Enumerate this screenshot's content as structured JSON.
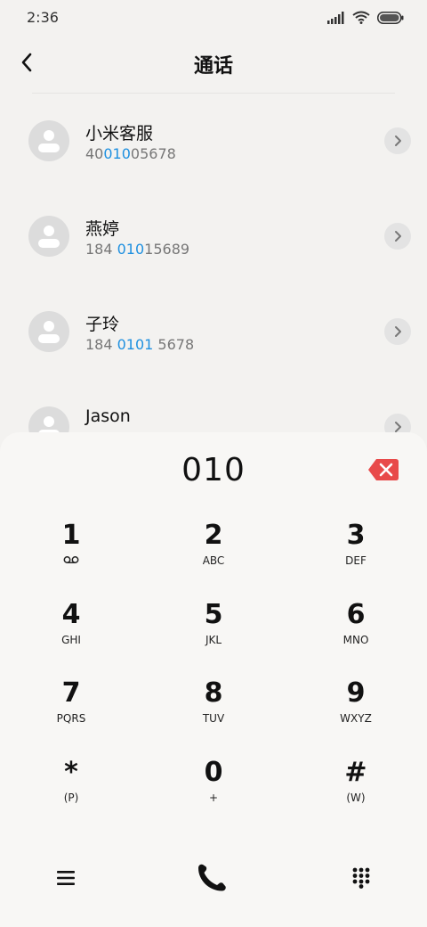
{
  "status_bar": {
    "time": "2:36"
  },
  "header": {
    "title": "通话"
  },
  "contacts": [
    {
      "name": "小米客服",
      "number_parts": [
        "40",
        "010",
        "05678"
      ]
    },
    {
      "name": "燕婷",
      "number_parts": [
        "184 ",
        "010",
        "15689"
      ]
    },
    {
      "name": "子玲",
      "number_parts": [
        "184 ",
        "0101",
        " 5678"
      ]
    },
    {
      "name": "Jason",
      "number_parts": [
        "",
        "",
        ""
      ]
    }
  ],
  "dialer": {
    "input": "010",
    "keys": [
      {
        "digit": "1",
        "letters": ""
      },
      {
        "digit": "2",
        "letters": "ABC"
      },
      {
        "digit": "3",
        "letters": "DEF"
      },
      {
        "digit": "4",
        "letters": "GHI"
      },
      {
        "digit": "5",
        "letters": "JKL"
      },
      {
        "digit": "6",
        "letters": "MNO"
      },
      {
        "digit": "7",
        "letters": "PQRS"
      },
      {
        "digit": "8",
        "letters": "TUV"
      },
      {
        "digit": "9",
        "letters": "WXYZ"
      },
      {
        "digit": "*",
        "letters": "(P)"
      },
      {
        "digit": "0",
        "letters": "+"
      },
      {
        "digit": "#",
        "letters": "(W)"
      }
    ]
  },
  "icons": {
    "back": "back-arrow-icon",
    "backspace": "backspace-icon",
    "menu": "menu-icon",
    "call": "phone-icon",
    "keypad": "keypad-icon",
    "voicemail": "voicemail-icon"
  },
  "colors": {
    "highlight": "#1e90e0",
    "backspace": "#e84a4a"
  }
}
